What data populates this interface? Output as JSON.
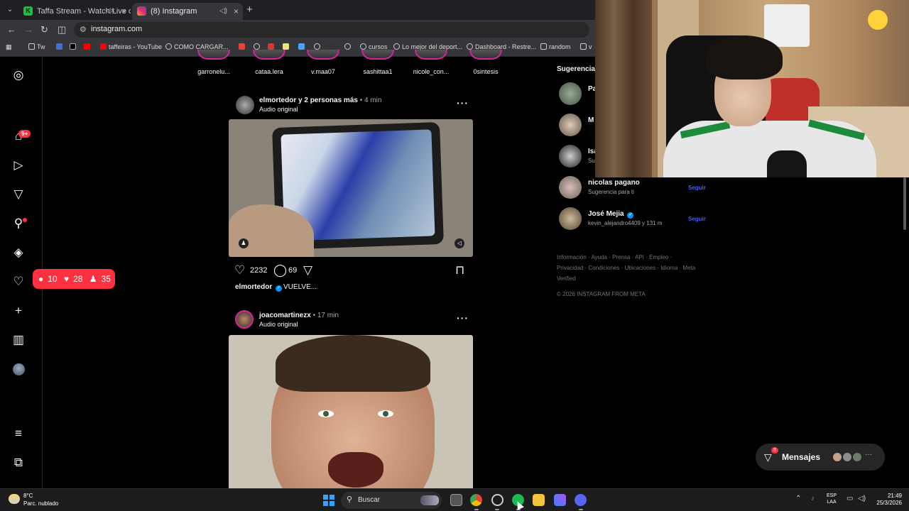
{
  "browser": {
    "tabs": [
      {
        "title": "Taffa Stream - Watch Live o",
        "favicon": "K"
      },
      {
        "title": "(8) Instagram"
      }
    ],
    "url": "instagram.com",
    "bookmarks": [
      "Tw",
      "taffeiras - YouTube",
      "COMO CARGAR...",
      "cursos",
      "Lo mejor del deport...",
      "Dashboard - Restre...",
      "random",
      "v"
    ]
  },
  "nav": {
    "messages_badge": "9+",
    "notif_comments": "10",
    "notif_likes": "28",
    "notif_follows": "35"
  },
  "stories": [
    "garronelu...",
    "cataa.lera",
    "v.maa07",
    "sashittaa1",
    "nicole_con...",
    "0sintesis"
  ],
  "post1": {
    "user": "elmortedor y 2 personas más",
    "time": "• 4 min",
    "audio": "Audio original",
    "likes": "2232",
    "comments": "69",
    "caption_user": "elmortedor",
    "caption_text": "VUELVE..."
  },
  "post2": {
    "user": "joacomartinezx",
    "time": "• 17 min",
    "audio": "Audio original"
  },
  "sidebar": {
    "title": "Sugerencias",
    "suggestions": [
      {
        "name": "Pa",
        "sub": ""
      },
      {
        "name": "M",
        "sub": ""
      },
      {
        "name": "Isa",
        "sub": "Su"
      },
      {
        "name": "nicolas pagano",
        "sub": "Sugerencia para ti",
        "action": "Seguir"
      },
      {
        "name": "José Mejia",
        "sub": "kevin_alejandro4409 y 131 m",
        "action": "Seguir"
      }
    ],
    "footer_links": "Información · Ayuda · Prensa · API · Empleo · Privacidad · Condiciones · Ubicaciones · Idioma · Meta Verified",
    "copyright": "© 2026 INSTAGRAM FROM META"
  },
  "messages": {
    "label": "Mensajes",
    "badge": "8",
    "more": "···"
  },
  "taskbar": {
    "temp": "8°C",
    "weather": "Parc. nublado",
    "search": "Buscar",
    "lang": "ESP",
    "region": "LAA",
    "time": "21:49",
    "date": "25/3/2026"
  },
  "colors": {
    "accent_red": "#ff3040",
    "link_blue": "#4a5df9",
    "verified_blue": "#0095f6"
  }
}
